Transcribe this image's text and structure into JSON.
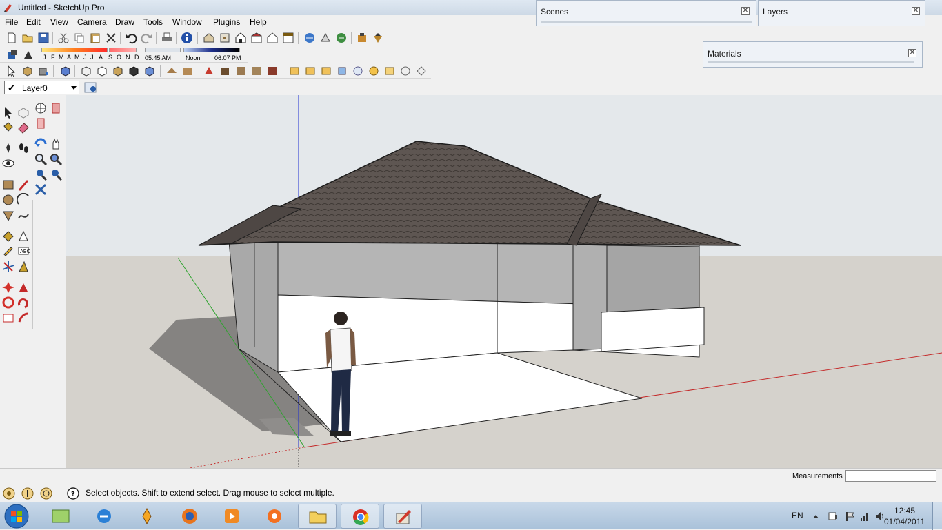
{
  "window": {
    "title": "Untitled - SketchUp Pro"
  },
  "menu": [
    "File",
    "Edit",
    "View",
    "Camera",
    "Draw",
    "Tools",
    "Window",
    "Plugins",
    "Help"
  ],
  "panels": {
    "scenes": {
      "title": "Scenes"
    },
    "layers": {
      "title": "Layers"
    },
    "materials": {
      "title": "Materials"
    }
  },
  "shadows": {
    "months": [
      "J",
      "F",
      "M",
      "A",
      "M",
      "J",
      "J",
      "A",
      "S",
      "O",
      "N",
      "D"
    ],
    "sunrise": "05:45 AM",
    "noon": "Noon",
    "sunset": "06:07 PM"
  },
  "layer": {
    "current": "Layer0"
  },
  "status": {
    "hint": "Select objects. Shift to extend select. Drag mouse to select multiple.",
    "measurements_label": "Measurements",
    "measurements_value": ""
  },
  "taskbar": {
    "lang": "EN",
    "time": "12:45",
    "date": "01/04/2011"
  },
  "colors": {
    "sky": "#e8ecef",
    "ground": "#d4d1cc",
    "roof": "#5a524f",
    "accent_blue": "#2b5ea7"
  }
}
